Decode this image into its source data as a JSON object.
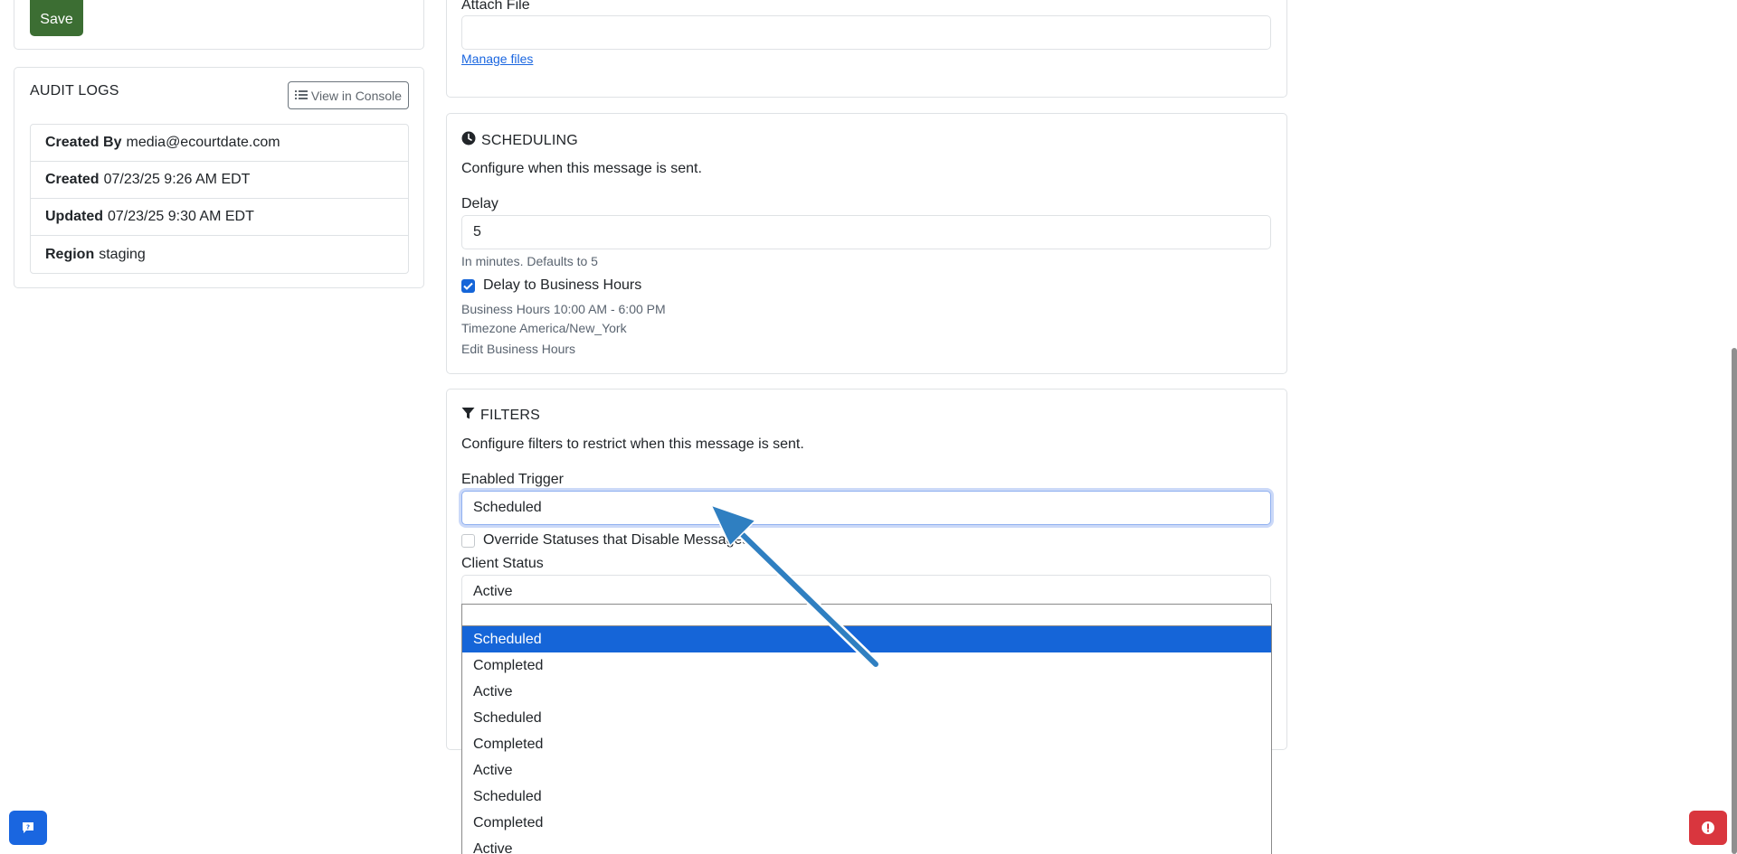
{
  "left_panel": {
    "save_label": "Save",
    "audit_logs": {
      "title": "AUDIT LOGS",
      "view_console_label": "View in Console",
      "rows": [
        {
          "key": "Created By",
          "value": "media@ecourtdate.com"
        },
        {
          "key": "Created",
          "value": "07/23/25 9:26 AM EDT"
        },
        {
          "key": "Updated",
          "value": "07/23/25 9:30 AM EDT"
        },
        {
          "key": "Region",
          "value": "staging"
        }
      ]
    }
  },
  "attachments": {
    "label": "Attach File",
    "value": "",
    "manage_link": "Manage files"
  },
  "scheduling": {
    "title": "SCHEDULING",
    "description": "Configure when this message is sent.",
    "delay_label": "Delay",
    "delay_value": "5",
    "delay_help": "In minutes. Defaults to 5",
    "business_hours_checkbox_label": "Delay to Business Hours",
    "business_hours_checked": true,
    "business_hours_text": "Business Hours 10:00 AM - 6:00 PM",
    "timezone_text": "Timezone America/New_York",
    "edit_link": "Edit Business Hours"
  },
  "filters": {
    "title": "FILTERS",
    "description": "Configure filters to restrict when this message is sent.",
    "trigger_label": "Enabled Trigger",
    "trigger_value": "Scheduled",
    "override_label": "Override Statuses that Disable Messages",
    "override_checked": false,
    "client_status_label": "Client Status",
    "client_status_value": "Active"
  },
  "dropdown": {
    "options": [
      "Scheduled",
      "Completed",
      "Active",
      "Scheduled",
      "Completed",
      "Active",
      "Scheduled",
      "Completed",
      "Active"
    ],
    "selected_index": 0
  },
  "colors": {
    "save_button": "#3c6e33",
    "primary": "#1565d8",
    "alert": "#d9363e",
    "annotation_arrow": "#2f7fc1"
  }
}
